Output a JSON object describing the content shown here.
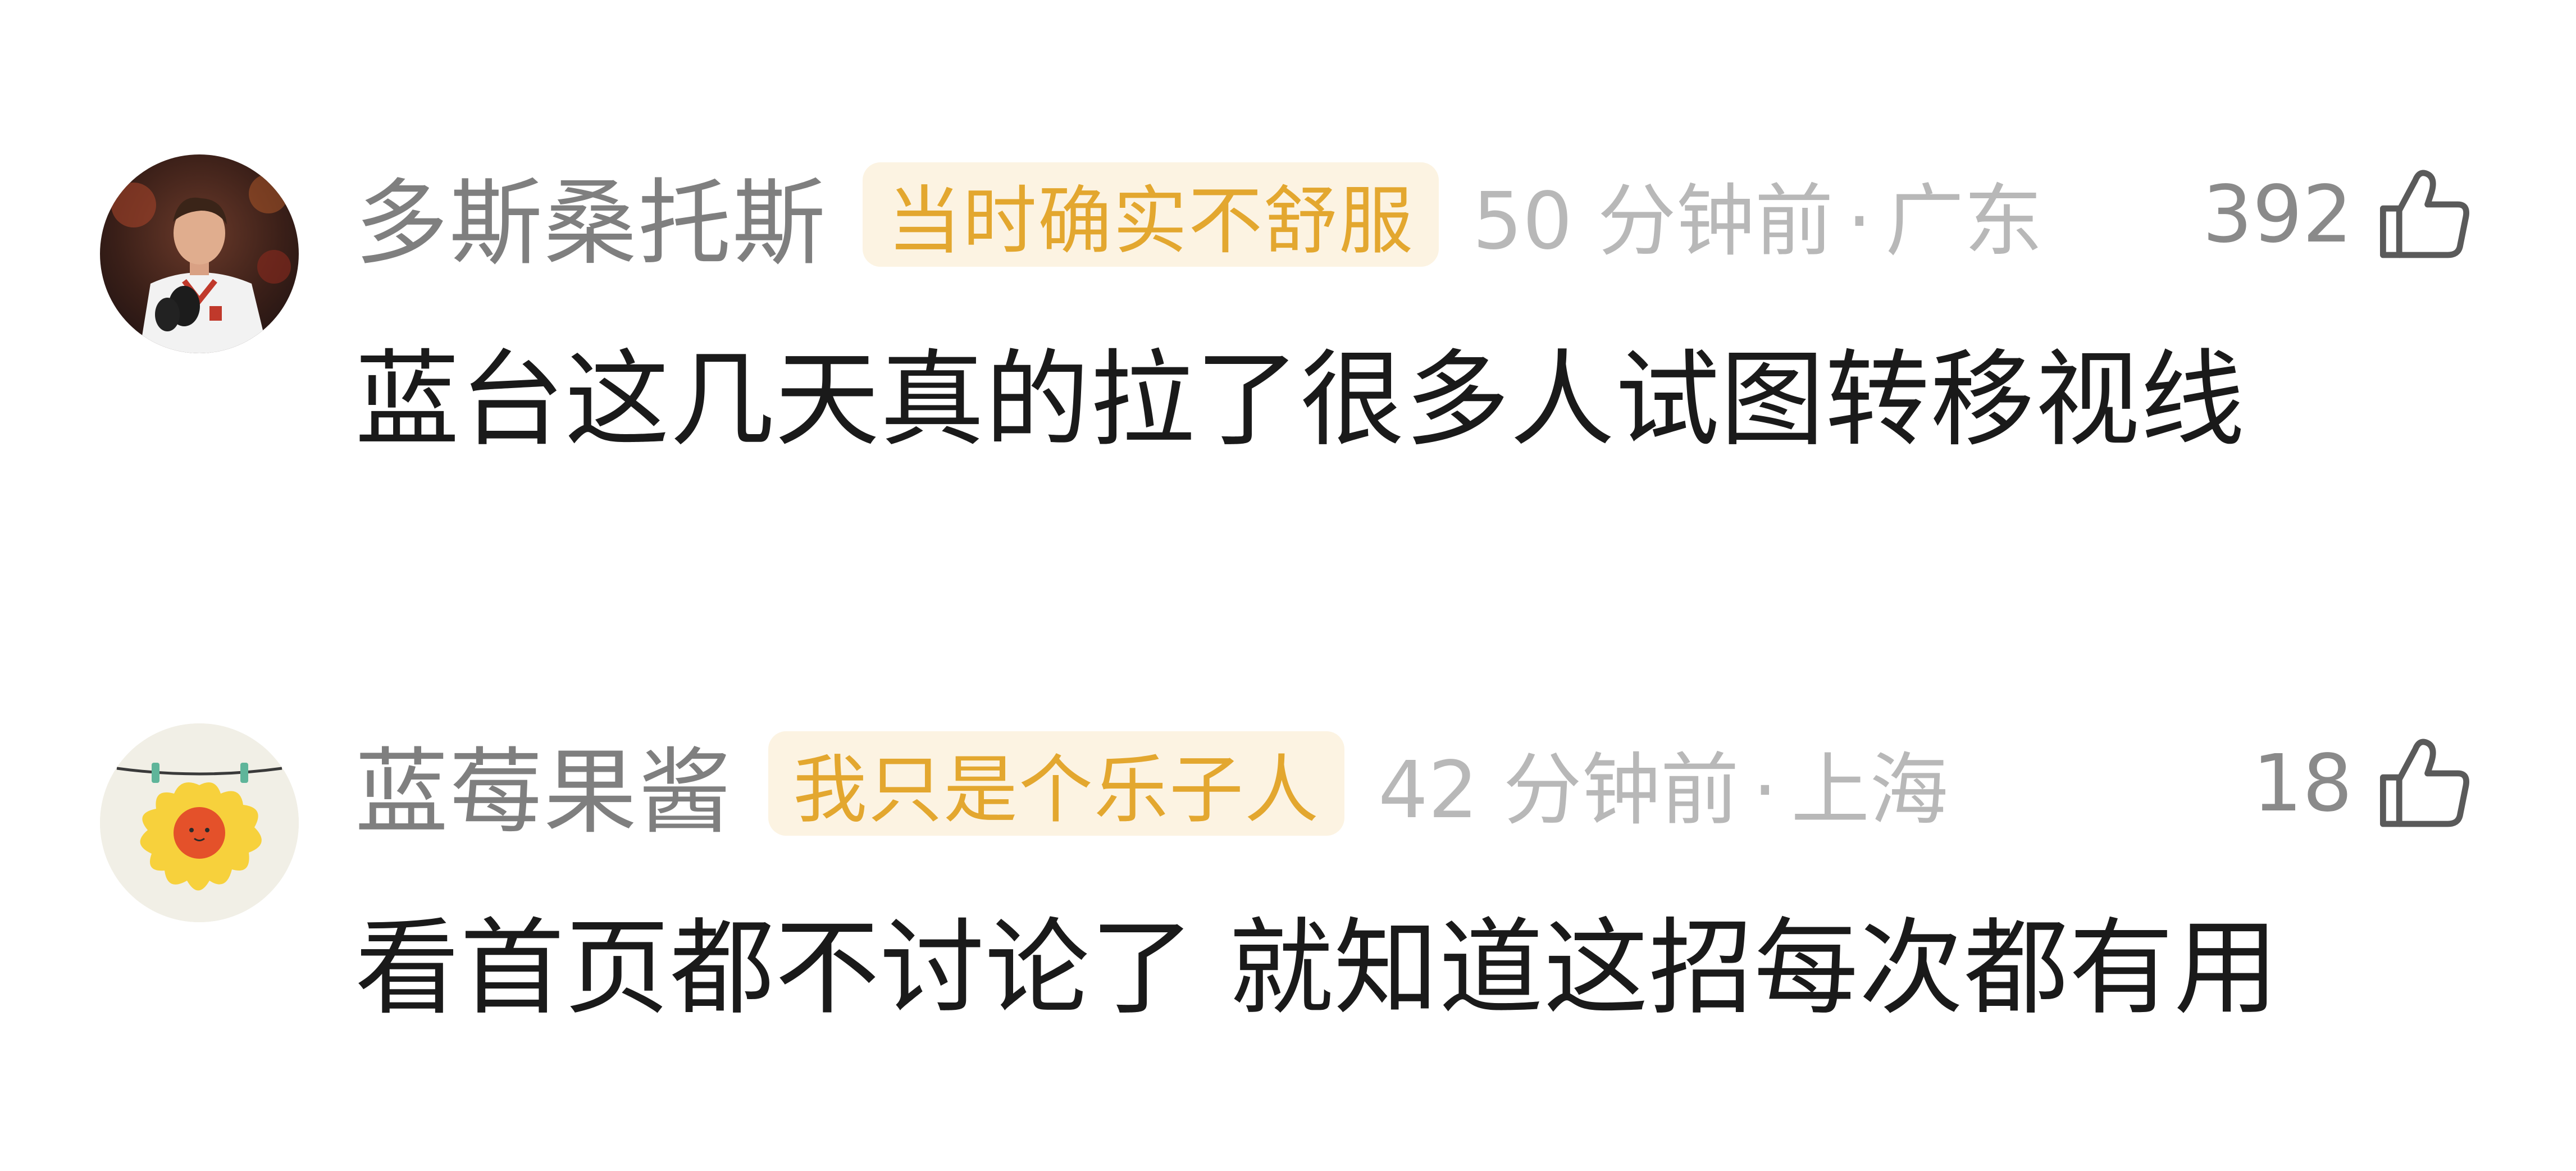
{
  "comments": [
    {
      "username": "多斯桑托斯",
      "badge": "当时确实不舒服",
      "time": "50 分钟前",
      "location": "广东",
      "likes": "392",
      "content": "蓝台这几天真的拉了很多人试图转移视线",
      "avatar_icon": "player-photo-avatar"
    },
    {
      "username": "蓝莓果酱",
      "badge": "我只是个乐子人",
      "time": "42 分钟前",
      "location": "上海",
      "likes": "18",
      "content": "看首页都不讨论了 就知道这招每次都有用",
      "avatar_icon": "sun-drying-avatar"
    }
  ],
  "separator": "·",
  "colors": {
    "username": "#7f7f7f",
    "badge_text": "#e3a72f",
    "badge_bg": "#fcf3e2",
    "meta": "#b8b8b8",
    "content": "#1a1a1a",
    "like_icon": "#5a5a5a"
  },
  "icons": {
    "like": "thumbs-up-icon"
  }
}
